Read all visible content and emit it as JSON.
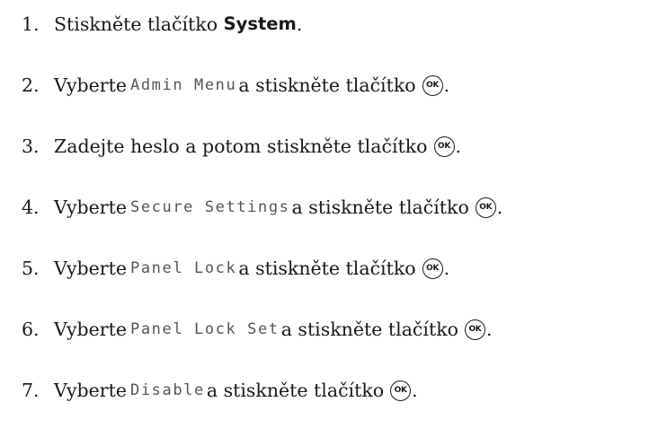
{
  "steps": [
    {
      "number": "1.",
      "lead": "Stiskněte tlačítko",
      "button": "System",
      "trail": "."
    },
    {
      "number": "2.",
      "lead": "Vyberte",
      "menu": "Admin Menu",
      "trail": "a stiskněte tlačítko",
      "end": "."
    },
    {
      "number": "3.",
      "lead": "Zadejte heslo a potom stiskněte tlačítko",
      "end": "."
    },
    {
      "number": "4.",
      "lead": "Vyberte",
      "menu": "Secure Settings",
      "trail": "a stiskněte tlačítko",
      "end": "."
    },
    {
      "number": "5.",
      "lead": "Vyberte",
      "menu": "Panel Lock",
      "trail": "a stiskněte tlačítko",
      "end": "."
    },
    {
      "number": "6.",
      "lead": "Vyberte",
      "menu": "Panel Lock Set",
      "trail": "a stiskněte tlačítko",
      "end": "."
    },
    {
      "number": "7.",
      "lead": "Vyberte",
      "menu": "Disable",
      "trail": "a stiskněte tlačítko",
      "end": "."
    }
  ],
  "icons": {
    "ok_label": "OK",
    "ok_icon_name": "ok-button-icon"
  }
}
